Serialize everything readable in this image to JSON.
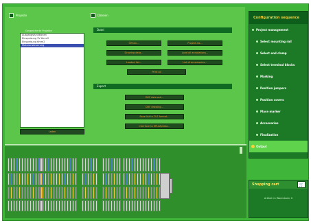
{
  "left_header": {
    "title": "Projekte"
  },
  "list_label": "Gespeicherte Projekte",
  "projects": [
    {
      "name": "Ausgangsfunktionen",
      "selected": false
    },
    {
      "name": "Einspeisung 3V 6mm2",
      "selected": false
    },
    {
      "name": "Einspeisung 6mm2",
      "selected": false
    },
    {
      "name": "Motoransteuerung",
      "selected": true
    }
  ],
  "list_button": "Laden",
  "right_header": {
    "title": "Dateien"
  },
  "file_section": {
    "label": "Datei",
    "buttons": [
      {
        "label": "Öffnen..."
      },
      {
        "label": "Projekt als..."
      },
      {
        "label": "Drawing data..."
      },
      {
        "label": "Load all annotations..."
      },
      {
        "label": "Loaded list..."
      },
      {
        "label": "List of accessories..."
      },
      {
        "label": "Print all"
      }
    ]
  },
  "export_section": {
    "label": "Export",
    "buttons": [
      {
        "label": "DXF data out..."
      },
      {
        "label": "DXF drawing..."
      },
      {
        "label": "Save list to CLS format..."
      },
      {
        "label": "Interface to EPLAN/data..."
      }
    ]
  },
  "config": {
    "title": "Configuration sequence",
    "steps": [
      {
        "label": "Project management",
        "sub": false,
        "active": false
      },
      {
        "label": "Select mounting rail",
        "sub": true,
        "active": false
      },
      {
        "label": "Select end clamp",
        "sub": true,
        "active": false
      },
      {
        "label": "Select terminal blocks",
        "sub": true,
        "active": false
      },
      {
        "label": "Marking",
        "sub": true,
        "active": false
      },
      {
        "label": "Position jumpers",
        "sub": true,
        "active": false
      },
      {
        "label": "Position covers",
        "sub": true,
        "active": false
      },
      {
        "label": "Place marker",
        "sub": true,
        "active": false
      },
      {
        "label": "Accessories",
        "sub": true,
        "active": false
      },
      {
        "label": "Finalization",
        "sub": true,
        "active": false
      },
      {
        "label": "Output",
        "sub": false,
        "active": true
      }
    ]
  },
  "cart": {
    "title": "Shopping cart",
    "summary": "Artikel im Warenkorb: 0"
  },
  "colors": {
    "background_green": "#3fb63a",
    "panel_green": "#1c7a27",
    "header_dark": "#0d5e1a",
    "button_text": "#f09a32",
    "active_step": "#5ed34b",
    "title_yellow": "#f4d23c"
  },
  "icons": {
    "cart": "shopping-cart-icon"
  }
}
